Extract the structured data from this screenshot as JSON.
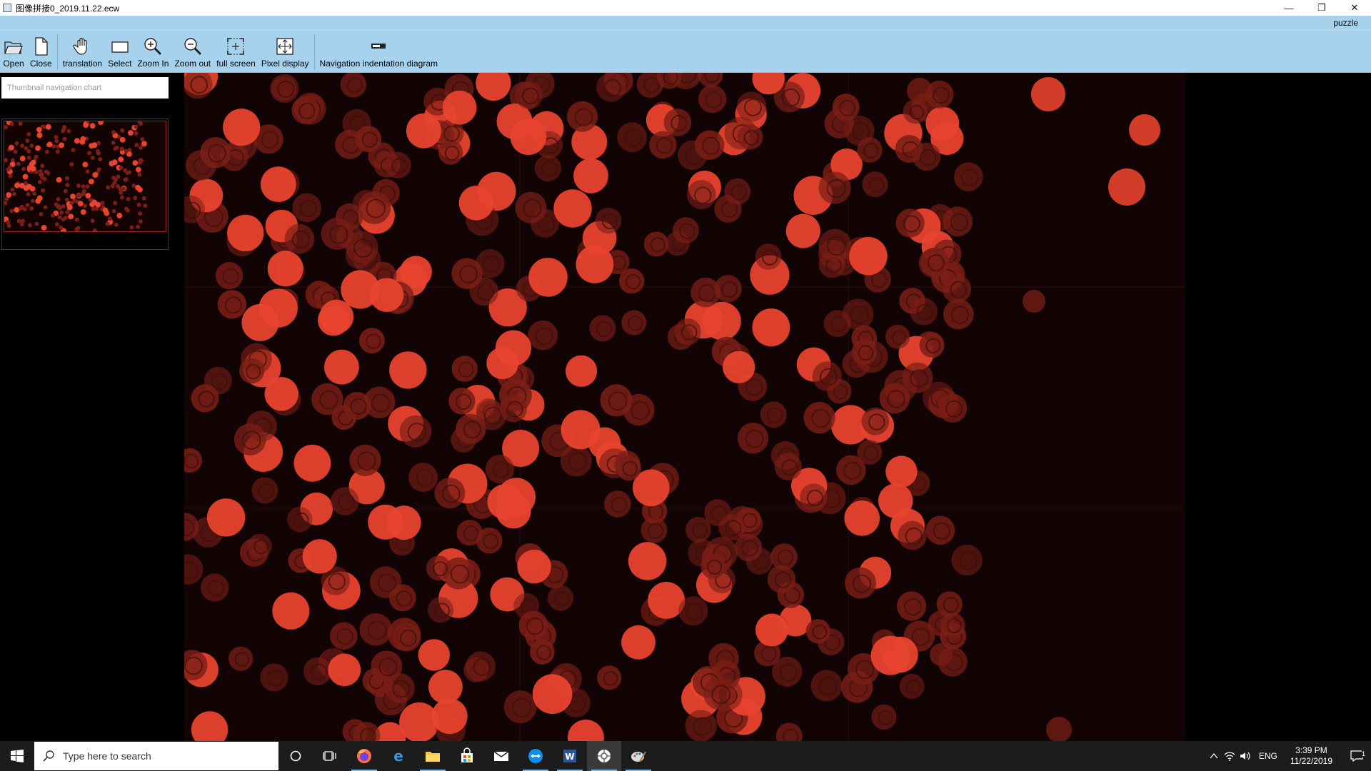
{
  "window": {
    "title": "图像拼接0_2019.11.22.ecw",
    "controls": {
      "minimize": "—",
      "restore": "❐",
      "close": "✕"
    }
  },
  "ribbon": {
    "tab": "puzzle",
    "tools": [
      {
        "id": "open",
        "label": "Open",
        "icon": "folder-open-icon"
      },
      {
        "id": "close",
        "label": "Close",
        "icon": "document-icon"
      },
      {
        "id": "translation",
        "label": "translation",
        "icon": "hand-icon"
      },
      {
        "id": "select",
        "label": "Select",
        "icon": "rectangle-icon"
      },
      {
        "id": "zoom-in",
        "label": "Zoom In",
        "icon": "zoom-in-icon"
      },
      {
        "id": "zoom-out",
        "label": "Zoom out",
        "icon": "zoom-out-icon"
      },
      {
        "id": "full-screen",
        "label": "full screen",
        "icon": "fullscreen-icon"
      },
      {
        "id": "pixel-display",
        "label": "Pixel display",
        "icon": "pixel-display-icon"
      },
      {
        "id": "nav-diagram",
        "label": "Navigation indentation diagram",
        "icon": "nav-diagram-icon"
      }
    ]
  },
  "thumbnail_panel": {
    "header": "Thumbnail navigation chart"
  },
  "colors": {
    "ribbon_bg": "#a7d2ee",
    "cell_bright": "#e8432e",
    "cell_dim": "#7a1e16",
    "viewport_bg": "#120405",
    "taskbar_bg": "#1c1c1c"
  },
  "taskbar": {
    "search_placeholder": "Type here to search",
    "apps": [
      "cortana-icon",
      "task-view-icon",
      "firefox-icon",
      "edge-icon",
      "file-explorer-icon",
      "store-icon",
      "mail-icon",
      "teamviewer-icon",
      "word-icon",
      "app-icon-active",
      "paint-icon"
    ],
    "tray": {
      "language": "ENG",
      "time": "3:39 PM",
      "date": "11/22/2019",
      "notifications": "1"
    }
  }
}
